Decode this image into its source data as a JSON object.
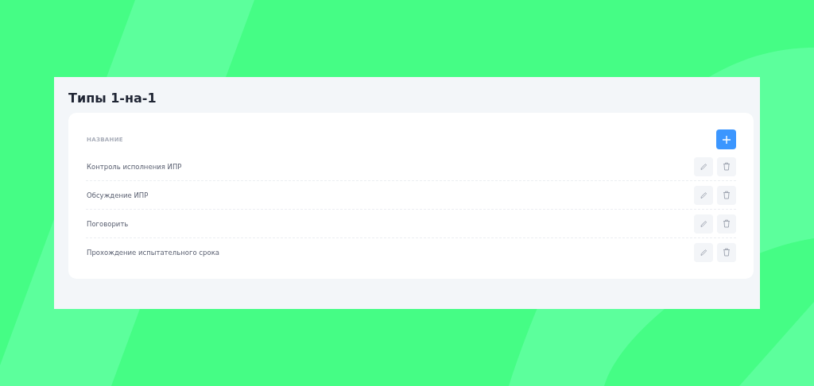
{
  "title": "Типы 1-на-1",
  "table": {
    "column": "НАЗВАНИЕ",
    "rows": [
      {
        "name": "Контроль исполнения ИПР"
      },
      {
        "name": "Обсуждение ИПР"
      },
      {
        "name": "Поговорить"
      },
      {
        "name": "Прохождение испытательного срока"
      }
    ]
  }
}
